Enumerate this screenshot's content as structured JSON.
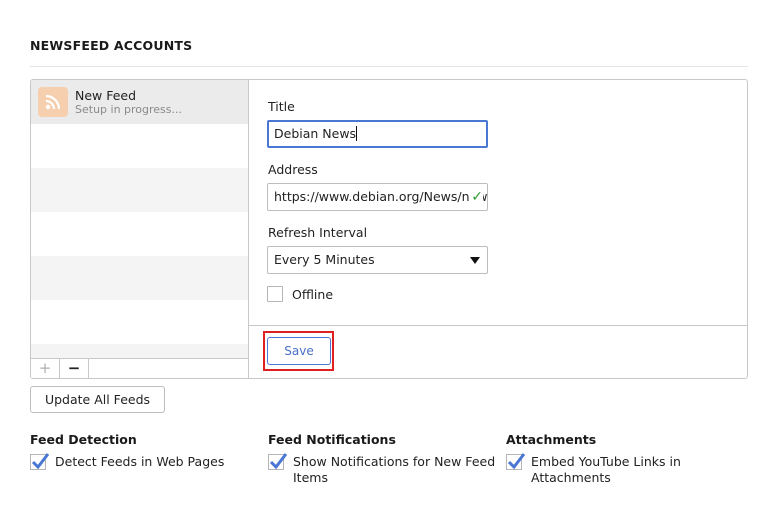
{
  "section": {
    "title": "NEWSFEED ACCOUNTS"
  },
  "feed_list": {
    "items": [
      {
        "title": "New Feed",
        "subtitle": "Setup in progress...",
        "icon": "rss-icon"
      }
    ],
    "add_label": "+",
    "remove_label": "−"
  },
  "form": {
    "title_label": "Title",
    "title_value": "Debian News",
    "address_label": "Address",
    "address_value": "https://www.debian.org/News/news",
    "address_status": "✓",
    "refresh_label": "Refresh Interval",
    "refresh_value": "Every 5 Minutes",
    "offline_label": "Offline",
    "offline_checked": false,
    "save_label": "Save"
  },
  "update_all_label": "Update All Feeds",
  "options": {
    "feed_detection": {
      "title": "Feed Detection",
      "label": "Detect Feeds in Web Pages",
      "checked": true
    },
    "feed_notifications": {
      "title": "Feed Notifications",
      "label_line1": "Show Notifications for New Feed",
      "label_line2": "Items",
      "checked": true
    },
    "attachments": {
      "title": "Attachments",
      "label_line1": "Embed YouTube Links in",
      "label_line2": "Attachments",
      "checked": true
    }
  },
  "colors": {
    "accent": "#4a77d4",
    "highlight": "#e02020",
    "feed_icon_bg": "#f5cfae",
    "ok": "#2e9a34"
  }
}
